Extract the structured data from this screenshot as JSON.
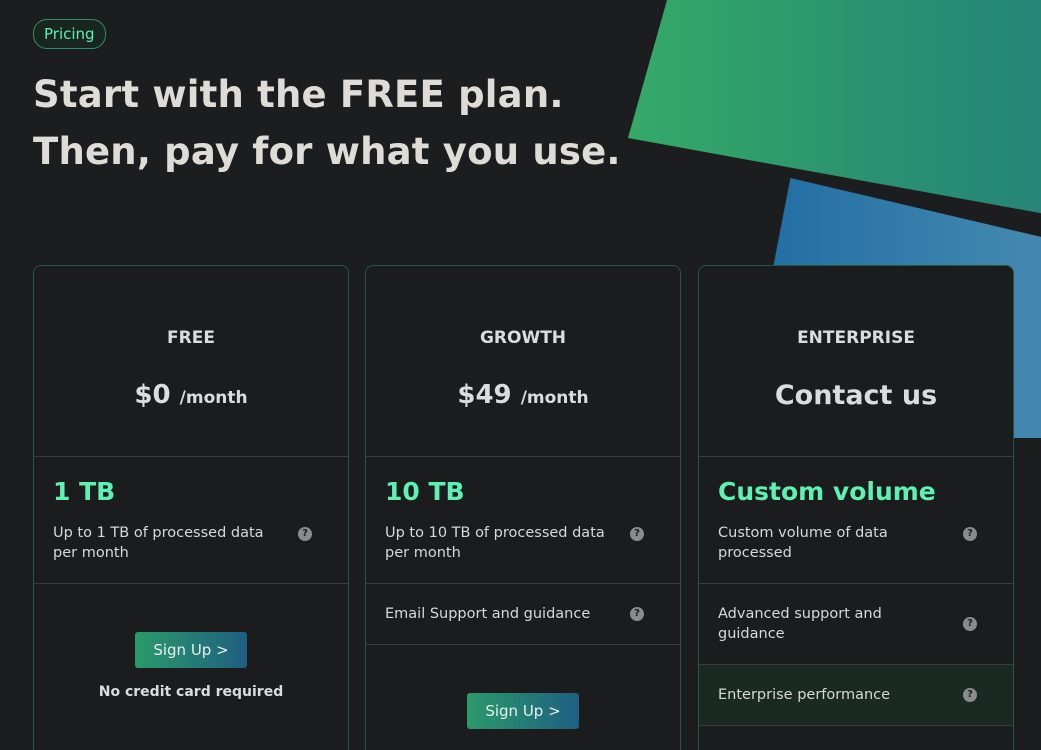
{
  "badge": "Pricing",
  "hero": {
    "line1": "Start with the FREE plan.",
    "line2": "Then, pay for what you use."
  },
  "plans": [
    {
      "name": "FREE",
      "price": "$0",
      "per": "/month",
      "volume_title": "1 TB",
      "volume_desc": "Up to 1 TB of processed data per month",
      "cta": "Sign Up >",
      "note": "No credit card required"
    },
    {
      "name": "GROWTH",
      "price": "$49",
      "per": "/month",
      "volume_title": "10 TB",
      "volume_desc": "Up to 10 TB of processed data per month",
      "features": [
        "Email Support and guidance"
      ],
      "cta": "Sign Up >"
    },
    {
      "name": "ENTERPRISE",
      "contact": "Contact us",
      "volume_title": "Custom volume",
      "volume_desc": "Custom volume of data processed",
      "features": [
        "Advanced support and guidance",
        "Enterprise performance"
      ]
    }
  ],
  "help_glyph": "?",
  "colors": {
    "accent": "#5ff0b3",
    "background": "#1c1d1f",
    "card_border": "#24573f"
  }
}
